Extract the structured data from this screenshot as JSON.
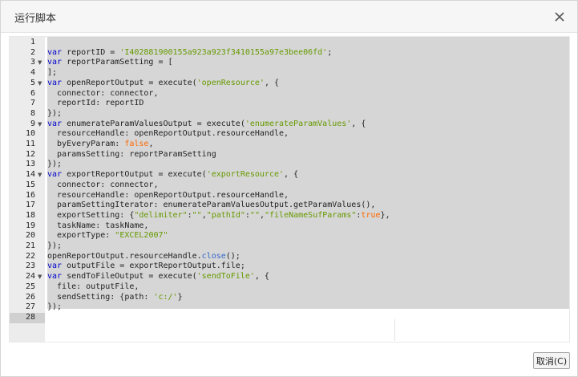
{
  "dialog": {
    "title": "运行脚本",
    "close_icon": "close-icon",
    "cancel_label": "取消(C)"
  },
  "editor": {
    "colors": {
      "keyword": "#0000cc",
      "string": "#669900",
      "boolean": "#ff6600",
      "method": "#3366cc",
      "selection": "#d6d6d6",
      "gutter": "#ececec"
    },
    "active_line": 28,
    "lines": [
      {
        "n": "1",
        "fold": false,
        "tokens": []
      },
      {
        "n": "2",
        "fold": false,
        "tokens": [
          [
            "kw",
            "var"
          ],
          [
            "t",
            " reportID = "
          ],
          [
            "str",
            "'I402881900155a923a923f3410155a97e3bee06fd'"
          ],
          [
            "t",
            ";"
          ]
        ]
      },
      {
        "n": "3",
        "fold": true,
        "tokens": [
          [
            "kw",
            "var"
          ],
          [
            "t",
            " reportParamSetting = ["
          ]
        ]
      },
      {
        "n": "4",
        "fold": false,
        "tokens": [
          [
            "t",
            "];"
          ]
        ]
      },
      {
        "n": "5",
        "fold": true,
        "tokens": [
          [
            "kw",
            "var"
          ],
          [
            "t",
            " openReportOutput = execute("
          ],
          [
            "str",
            "'openResource'"
          ],
          [
            "t",
            ", {"
          ]
        ]
      },
      {
        "n": "6",
        "fold": false,
        "tokens": [
          [
            "t",
            "  connector: connector,"
          ]
        ]
      },
      {
        "n": "7",
        "fold": false,
        "tokens": [
          [
            "t",
            "  reportId: reportID"
          ]
        ]
      },
      {
        "n": "8",
        "fold": false,
        "tokens": [
          [
            "t",
            "});"
          ]
        ]
      },
      {
        "n": "9",
        "fold": true,
        "tokens": [
          [
            "kw",
            "var"
          ],
          [
            "t",
            " enumerateParamValuesOutput = execute("
          ],
          [
            "str",
            "'enumerateParamValues'"
          ],
          [
            "t",
            ", {"
          ]
        ]
      },
      {
        "n": "10",
        "fold": false,
        "tokens": [
          [
            "t",
            "  resourceHandle: openReportOutput.resourceHandle,"
          ]
        ]
      },
      {
        "n": "11",
        "fold": false,
        "tokens": [
          [
            "t",
            "  byEveryParam: "
          ],
          [
            "bool",
            "false"
          ],
          [
            "t",
            ","
          ]
        ]
      },
      {
        "n": "12",
        "fold": false,
        "tokens": [
          [
            "t",
            "  paramsSetting: reportParamSetting"
          ]
        ]
      },
      {
        "n": "13",
        "fold": false,
        "tokens": [
          [
            "t",
            "});"
          ]
        ]
      },
      {
        "n": "14",
        "fold": true,
        "tokens": [
          [
            "kw",
            "var"
          ],
          [
            "t",
            " exportReportOutput = execute("
          ],
          [
            "str",
            "'exportResource'"
          ],
          [
            "t",
            ", {"
          ]
        ]
      },
      {
        "n": "15",
        "fold": false,
        "tokens": [
          [
            "t",
            "  connector: connector,"
          ]
        ]
      },
      {
        "n": "16",
        "fold": false,
        "tokens": [
          [
            "t",
            "  resourceHandle: openReportOutput.resourceHandle,"
          ]
        ]
      },
      {
        "n": "17",
        "fold": false,
        "tokens": [
          [
            "t",
            "  paramSettingIterator: enumerateParamValuesOutput.getParamValues(),"
          ]
        ]
      },
      {
        "n": "18",
        "fold": false,
        "tokens": [
          [
            "t",
            "  exportSetting: {"
          ],
          [
            "str",
            "\"delimiter\""
          ],
          [
            "t",
            ":"
          ],
          [
            "str",
            "\"\""
          ],
          [
            "t",
            ","
          ],
          [
            "str",
            "\"pathId\""
          ],
          [
            "t",
            ":"
          ],
          [
            "str",
            "\"\""
          ],
          [
            "t",
            ","
          ],
          [
            "str",
            "\"fileNameSufParams\""
          ],
          [
            "t",
            ":"
          ],
          [
            "bool",
            "true"
          ],
          [
            "t",
            "},"
          ]
        ]
      },
      {
        "n": "19",
        "fold": false,
        "tokens": [
          [
            "t",
            "  taskName: taskName,"
          ]
        ]
      },
      {
        "n": "20",
        "fold": false,
        "tokens": [
          [
            "t",
            "  exportType: "
          ],
          [
            "str",
            "\"EXCEL2007\""
          ]
        ]
      },
      {
        "n": "21",
        "fold": false,
        "tokens": [
          [
            "t",
            "});"
          ]
        ]
      },
      {
        "n": "22",
        "fold": false,
        "tokens": [
          [
            "t",
            "openReportOutput.resourceHandle."
          ],
          [
            "meth",
            "close"
          ],
          [
            "t",
            "();"
          ]
        ]
      },
      {
        "n": "23",
        "fold": false,
        "tokens": [
          [
            "kw",
            "var"
          ],
          [
            "t",
            " outputFile = exportReportOutput.file;"
          ]
        ]
      },
      {
        "n": "24",
        "fold": true,
        "tokens": [
          [
            "kw",
            "var"
          ],
          [
            "t",
            " sendToFileOutput = execute("
          ],
          [
            "str",
            "'sendToFile'"
          ],
          [
            "t",
            ", {"
          ]
        ]
      },
      {
        "n": "25",
        "fold": false,
        "tokens": [
          [
            "t",
            "  file: outputFile,"
          ]
        ]
      },
      {
        "n": "26",
        "fold": false,
        "tokens": [
          [
            "t",
            "  sendSetting: {path: "
          ],
          [
            "str",
            "'c:/'"
          ],
          [
            "t",
            "}"
          ]
        ]
      },
      {
        "n": "27",
        "fold": false,
        "tokens": [
          [
            "t",
            "});"
          ]
        ]
      },
      {
        "n": "28",
        "fold": false,
        "tokens": []
      }
    ]
  }
}
